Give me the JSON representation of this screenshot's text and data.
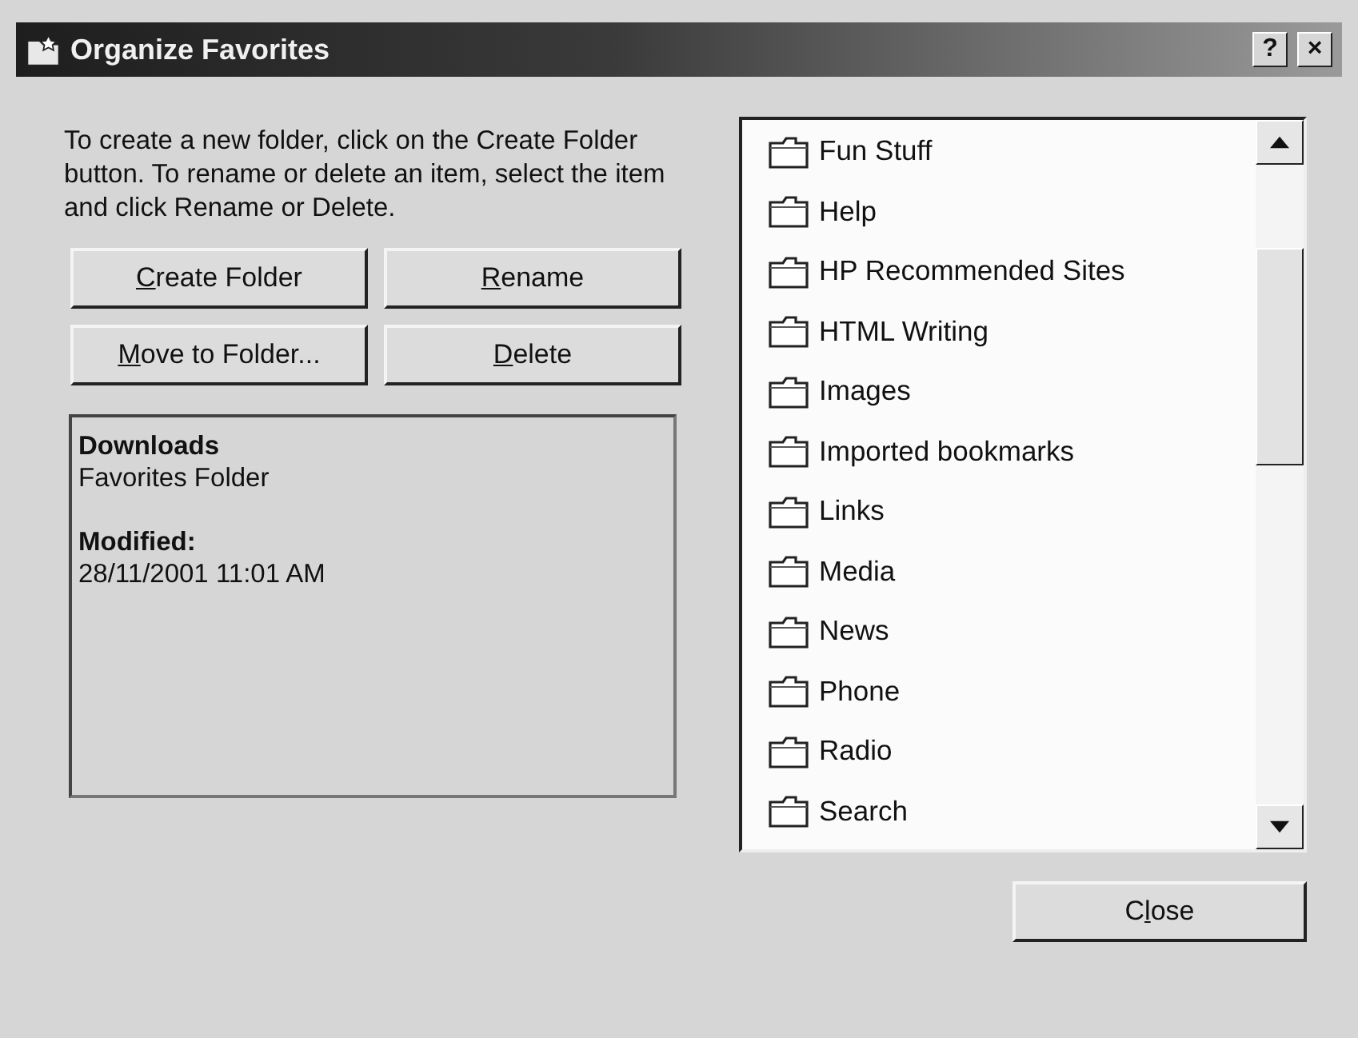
{
  "window": {
    "title": "Organize Favorites",
    "help_button": "?",
    "close_button": "×"
  },
  "instructions": "To create a new folder, click on the Create Folder button. To rename or delete an item, select the item and click Rename or Delete.",
  "buttons": [
    {
      "key": "C",
      "after": "reate Folder"
    },
    {
      "key": "R",
      "after": "ename"
    },
    {
      "key": "M",
      "after": "ove to Folder..."
    },
    {
      "key": "D",
      "after": "elete"
    }
  ],
  "details": {
    "name": "Downloads",
    "type": "Favorites Folder",
    "modified_label": "Modified:",
    "modified": "28/11/2001 11:01 AM"
  },
  "folders": [
    "Fun Stuff",
    "Help",
    "HP Recommended Sites",
    "HTML Writing",
    "Images",
    "Imported bookmarks",
    "Links",
    "Media",
    "News",
    "Phone",
    "Radio",
    "Search"
  ],
  "close_button": {
    "before": "C",
    "key": "l",
    "after": "ose"
  }
}
